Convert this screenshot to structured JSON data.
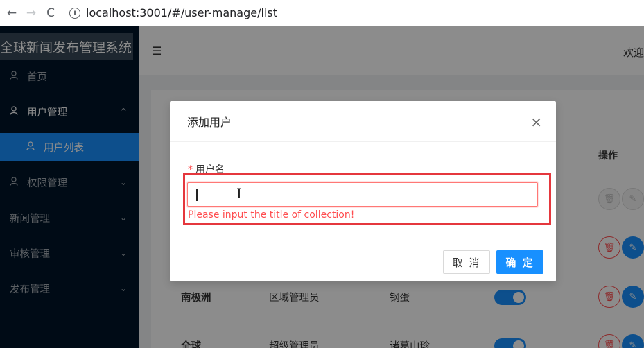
{
  "browser": {
    "back": "←",
    "forward": "→",
    "reload": "C",
    "info": "i",
    "url": "localhost:3001/#/user-manage/list"
  },
  "app": {
    "title": "全球新闻发布管理系统",
    "welcome": "欢迎"
  },
  "sidebar": {
    "items": [
      {
        "label": "首页",
        "icon": "user-icon"
      },
      {
        "label": "用户管理",
        "icon": "user-icon",
        "arrow": "^"
      },
      {
        "label": "用户列表",
        "icon": "user-icon"
      },
      {
        "label": "权限管理",
        "icon": "user-icon",
        "arrow": "⌄"
      },
      {
        "label": "新闻管理",
        "arrow": "⌄"
      },
      {
        "label": "审核管理",
        "arrow": "⌄"
      },
      {
        "label": "发布管理",
        "arrow": "⌄"
      }
    ]
  },
  "header": {
    "fold_icon": "☰"
  },
  "table": {
    "op_header": "操作",
    "rows": [
      {
        "region": "南极洲",
        "role": "区域管理员",
        "username": "钢蛋"
      },
      {
        "region": "全球",
        "role": "超级管理员",
        "username": "诸葛山珍"
      }
    ]
  },
  "modal": {
    "title": "添加用户",
    "close": "×",
    "label": "用户名",
    "required_mark": "*",
    "input_value": "",
    "error": "Please input the title of collection!",
    "cancel": "取 消",
    "ok": "确 定"
  },
  "colors": {
    "primary": "#1890ff",
    "error": "#ff4d4f",
    "sidebar": "#001529",
    "highlight": "#e5373d"
  }
}
